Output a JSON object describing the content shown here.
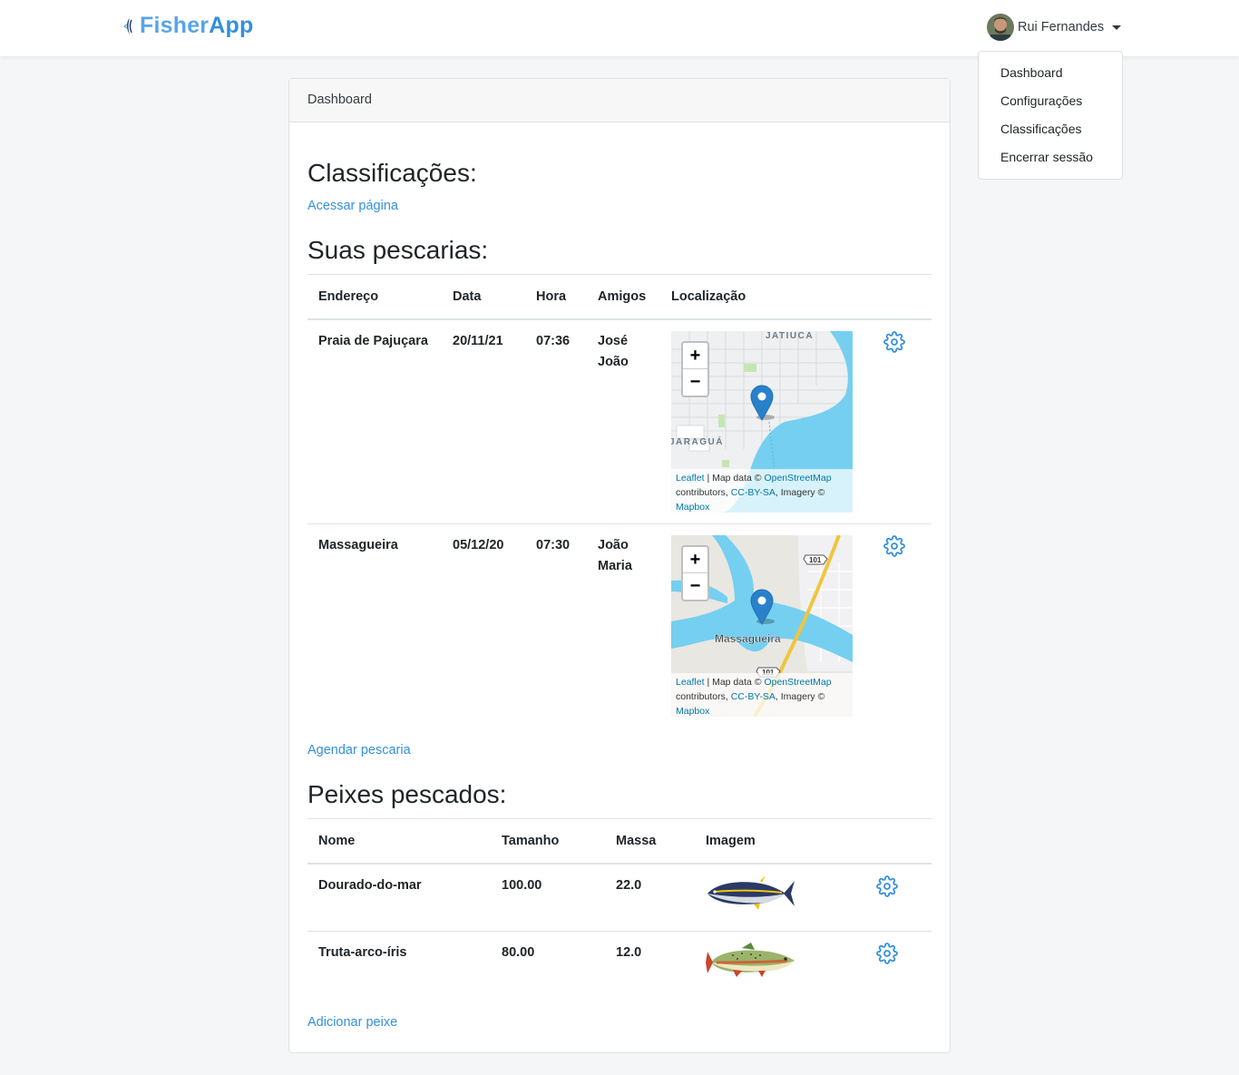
{
  "navbar": {
    "brand_first": "Fisher",
    "brand_second": "App",
    "user_name": "Rui Fernandes"
  },
  "dropdown": {
    "items": [
      "Dashboard",
      "Configurações",
      "Classificações",
      "Encerrar sessão"
    ]
  },
  "card": {
    "header": "Dashboard",
    "classificacoes_title": "Classificações:",
    "classificacoes_link": "Acessar página",
    "pescarias_title": "Suas pescarias:",
    "pescarias_columns": [
      "Endereço",
      "Data",
      "Hora",
      "Amigos",
      "Localização"
    ],
    "pescarias": [
      {
        "endereco": "Praia de Pajuçara",
        "data": "20/11/21",
        "hora": "07:36",
        "amigos": [
          "José",
          "João"
        ],
        "map_labels": [
          "JATIUCA",
          "JARAGUÁ"
        ]
      },
      {
        "endereco": "Massagueira",
        "data": "05/12/20",
        "hora": "07:30",
        "amigos": [
          "João",
          "Maria"
        ],
        "map_labels": [
          "Massagueira",
          "101",
          "101"
        ]
      }
    ],
    "map_attribution": {
      "leaflet": "Leaflet",
      "sep": " | Map data © ",
      "osm": "OpenStreetMap",
      "contributors": " contributors, ",
      "license": "CC-BY-SA",
      "imagery": ", Imagery © ",
      "mapbox": "Mapbox"
    },
    "zoom_in": "+",
    "zoom_out": "−",
    "agendar_link": "Agendar pescaria",
    "peixes_title": "Peixes pescados:",
    "peixes_columns": [
      "Nome",
      "Tamanho",
      "Massa",
      "Imagem"
    ],
    "peixes": [
      {
        "nome": "Dourado-do-mar",
        "tamanho": "100.00",
        "massa": "22.0"
      },
      {
        "nome": "Truta-arco-íris",
        "tamanho": "80.00",
        "massa": "12.0"
      }
    ],
    "adicionar_link": "Adicionar peixe"
  },
  "colors": {
    "accent": "#3490dc",
    "brand_light": "#5aa4e6",
    "water": "#75cff0",
    "marker": "#2a81cb"
  }
}
